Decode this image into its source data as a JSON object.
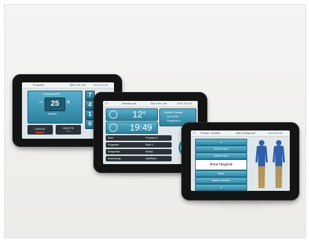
{
  "screens": {
    "left": {
      "header_left": "Productive",
      "header_mid": "Bed 6 Ver. Uhr",
      "header_right": "10:11 12.5.15",
      "panel_title": "Anpassung Zeit",
      "value": "25",
      "unit": "Minuten",
      "keys": [
        "7",
        "4",
        "1",
        "0"
      ],
      "cancel_label": "CANCEL",
      "delete_label": "DELETE",
      "delete_sub": "Anw"
    },
    "middle": {
      "header_title": "Menübar aus",
      "header_mid": "Bed 6 Ver. Uhr",
      "header_right": "10:11 12.5.15",
      "temperature": "12°",
      "time": "19:49",
      "info_title": "Aktuelle Therapie",
      "info_lines": [
        "Zeit 15 Min",
        "Programm A"
      ],
      "list_items": [
        {
          "label": "Stufe",
          "value": "Produktiv A"
        },
        {
          "label": "Programm",
          "value": "Stufe 1"
        },
        {
          "label": "Temperatur",
          "value": "Modus"
        },
        {
          "label": "Anwendung",
          "value": "Kalt/Warm"
        }
      ]
    },
    "right": {
      "header_left": "Produkt · Auswahl",
      "header_mid": "Bad 6 Anlage Zeit",
      "header_right": "10:11 12.5.15",
      "items_above": [
        "Rücken oben",
        "Rücken unten"
      ],
      "selected_item": "Arme hängend",
      "items_below": [
        "Beine",
        "Nacken Schulter"
      ]
    }
  },
  "colors": {
    "accent": "#2b7f9c",
    "bezel": "#141414",
    "screen_bg": "#dfe6ea",
    "body_figure": "#2f5fa8",
    "highlight": "#d8a445"
  }
}
